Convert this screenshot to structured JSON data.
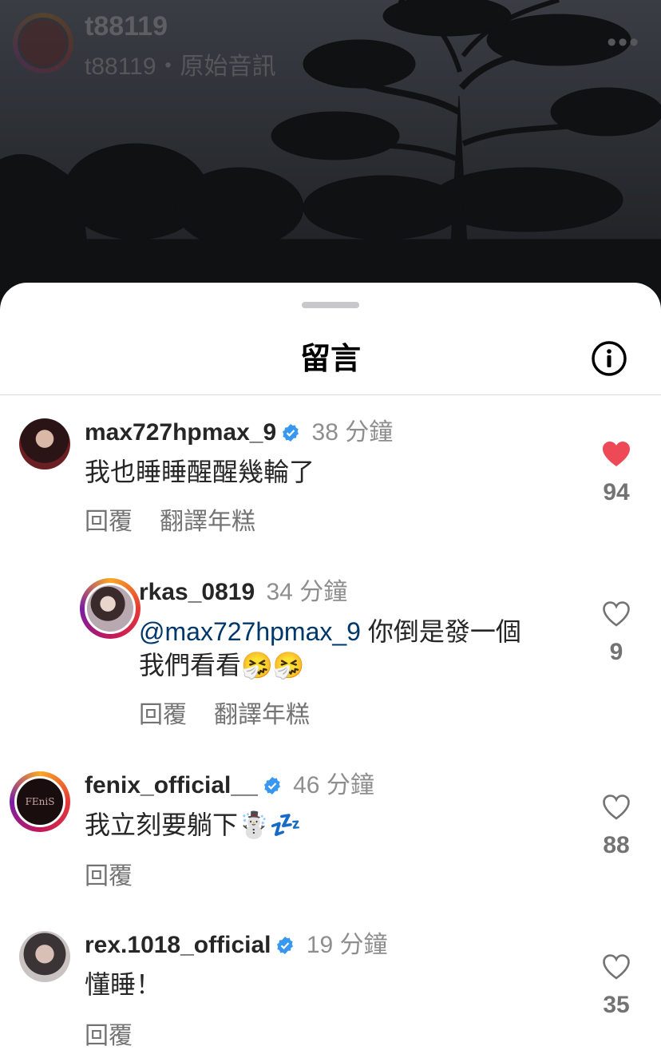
{
  "header": {
    "username": "t88119",
    "audio": "t88119・原始音訊",
    "more": "•••"
  },
  "sheet": {
    "title": "留言"
  },
  "comments": [
    {
      "username": "max727hpmax_9",
      "verified": true,
      "time": "38 分鐘",
      "text": "我也睡睡醒醒幾輪了",
      "reply": "回覆",
      "translate": "翻譯年糕",
      "likes": "94",
      "liked": true
    },
    {
      "username": "rkas_0819",
      "verified": false,
      "time": "34 分鐘",
      "mention": "@max727hpmax_9",
      "text_line1": " 你倒是發一個",
      "text_line2": "我們看看🤧🤧",
      "reply": "回覆",
      "translate": "翻譯年糕",
      "likes": "9",
      "liked": false
    },
    {
      "username": "fenix_official__",
      "verified": true,
      "time": "46 分鐘",
      "text": "我立刻要躺下☃️💤",
      "reply": "回覆",
      "likes": "88",
      "liked": false
    },
    {
      "username": "rex.1018_official",
      "verified": true,
      "time": "19 分鐘",
      "text": "懂睡！",
      "reply": "回覆",
      "likes": "35",
      "liked": false
    }
  ],
  "colors": {
    "like_red": "#ed4956",
    "verified_blue": "#3897f0",
    "mention": "#00376b"
  },
  "icons": [
    "info-icon",
    "verified-icon",
    "heart-icon",
    "heart-outline-icon",
    "more-icon"
  ]
}
